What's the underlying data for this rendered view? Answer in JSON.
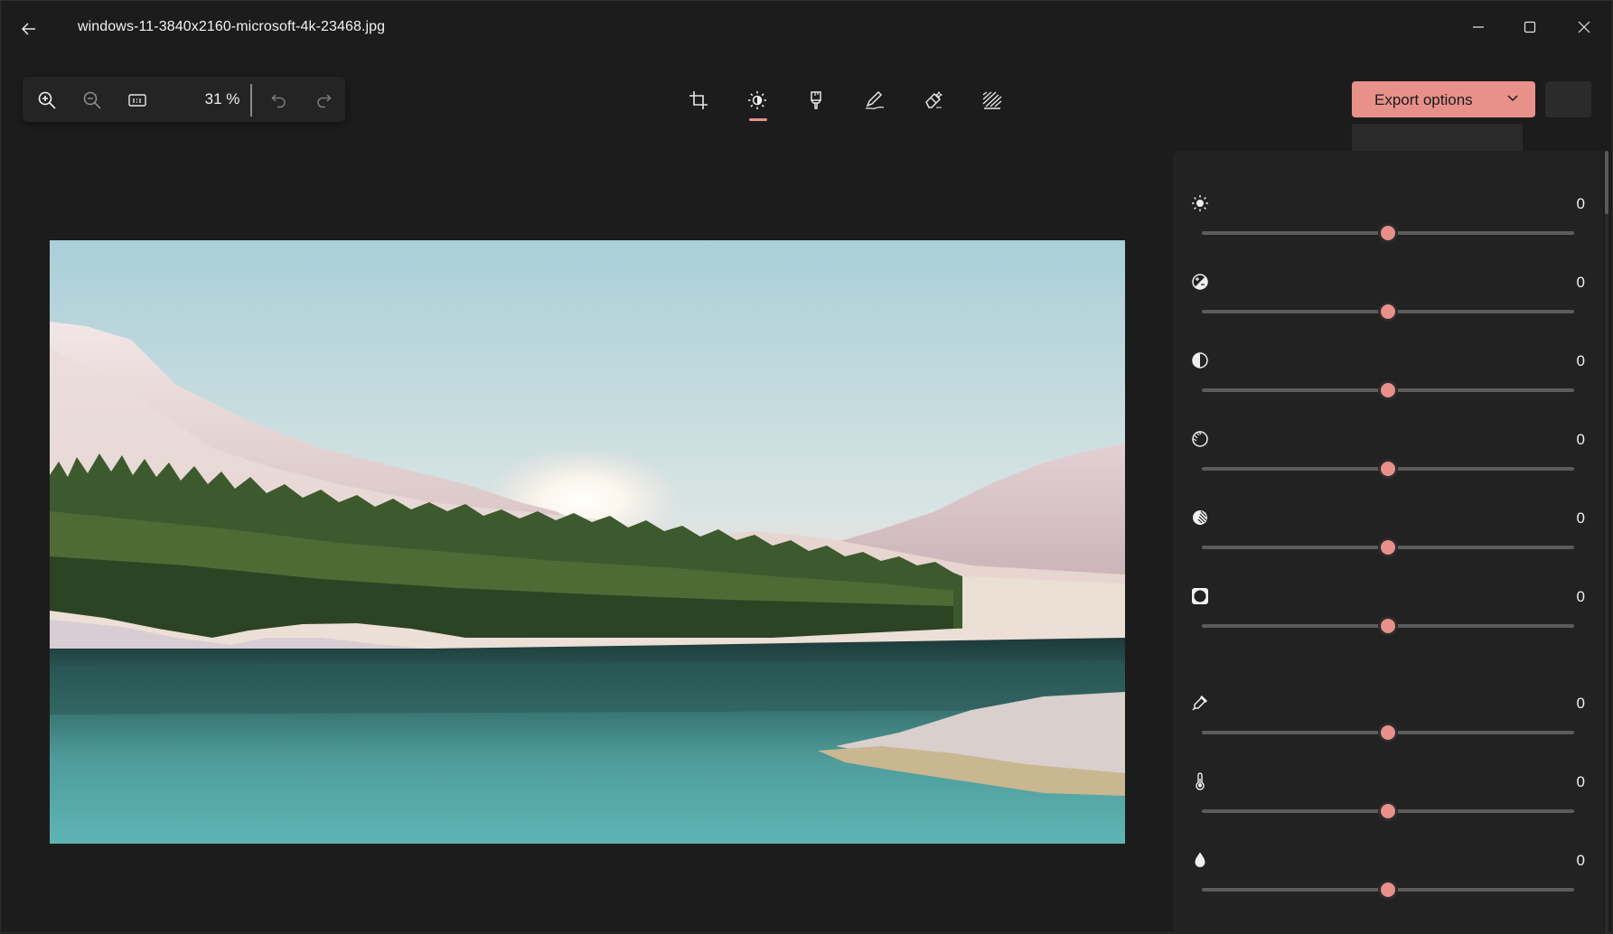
{
  "window": {
    "title": "windows-11-3840x2160-microsoft-4k-23468.jpg"
  },
  "zoom": {
    "value": "31 %"
  },
  "toolbar": {
    "tools": [
      {
        "name": "crop-tool",
        "icon": "crop-icon",
        "active": false
      },
      {
        "name": "adjustment-tool",
        "icon": "brightness-icon",
        "active": true
      },
      {
        "name": "filter-tool",
        "icon": "filter-icon",
        "active": false
      },
      {
        "name": "markup-tool",
        "icon": "pen-icon",
        "active": false
      },
      {
        "name": "erase-tool",
        "icon": "eraser-icon",
        "active": false
      },
      {
        "name": "background-tool",
        "icon": "background-blur-icon",
        "active": false
      }
    ]
  },
  "export": {
    "label": "Export options"
  },
  "colors": {
    "accent": "#e8908a",
    "background": "#1c1c1c",
    "panel": "#222222"
  },
  "adjustments": [
    {
      "id": "brightness",
      "icon": "brightness-icon",
      "value": "0",
      "level": 0.5
    },
    {
      "id": "exposure",
      "icon": "exposure-icon",
      "value": "0",
      "level": 0.5
    },
    {
      "id": "contrast",
      "icon": "contrast-icon",
      "value": "0",
      "level": 0.5
    },
    {
      "id": "highlights",
      "icon": "highlights-icon",
      "value": "0",
      "level": 0.5
    },
    {
      "id": "shadows",
      "icon": "shadows-icon",
      "value": "0",
      "level": 0.5
    },
    {
      "id": "vignette",
      "icon": "vignette-icon",
      "value": "0",
      "level": 0.5
    },
    {
      "id": "tint",
      "icon": "eyedropper-icon",
      "value": "0",
      "level": 0.5
    },
    {
      "id": "warmth",
      "icon": "thermometer-icon",
      "value": "0",
      "level": 0.5
    },
    {
      "id": "saturation",
      "icon": "droplet-icon",
      "value": "0",
      "level": 0.5
    }
  ]
}
